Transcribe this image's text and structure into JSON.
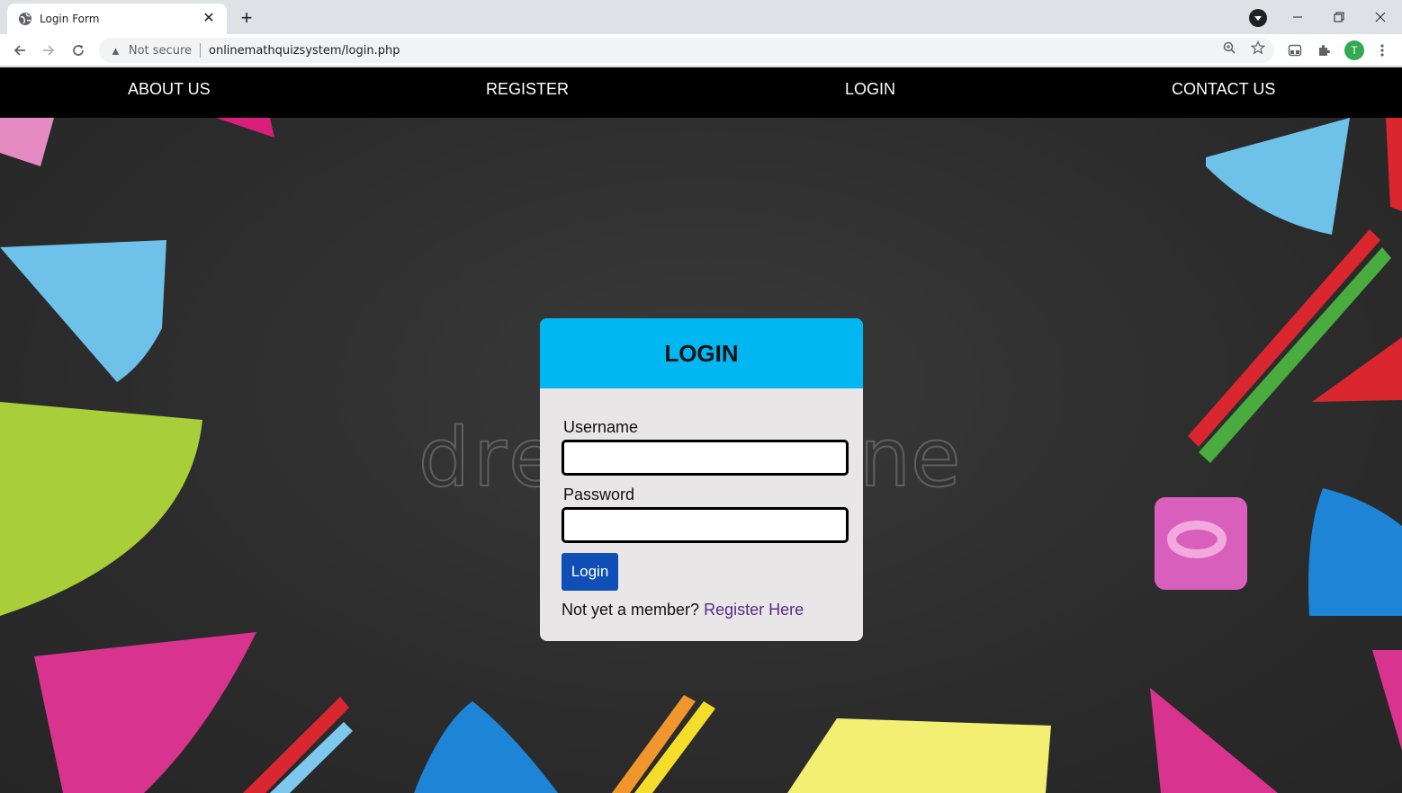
{
  "browser": {
    "tab_title": "Login Form",
    "tab_close": "✕",
    "new_tab": "+",
    "security_label": "Not secure",
    "url": "onlinemathquizsystem/login.php",
    "profile_initial": "T"
  },
  "navbar": {
    "about": "ABOUT US",
    "register": "REGISTER",
    "login": "LOGIN",
    "contact": "CONTACT US"
  },
  "background": {
    "watermark_left": "dre",
    "watermark_right": "ne"
  },
  "login_form": {
    "title": "LOGIN",
    "username_label": "Username",
    "username_value": "",
    "password_label": "Password",
    "password_value": "",
    "submit_label": "Login",
    "member_prompt": "Not yet a member?",
    "register_link": "Register Here"
  },
  "colors": {
    "card_header": "#00b7f1",
    "button": "#0f4fb5",
    "link": "#5b2a86"
  }
}
